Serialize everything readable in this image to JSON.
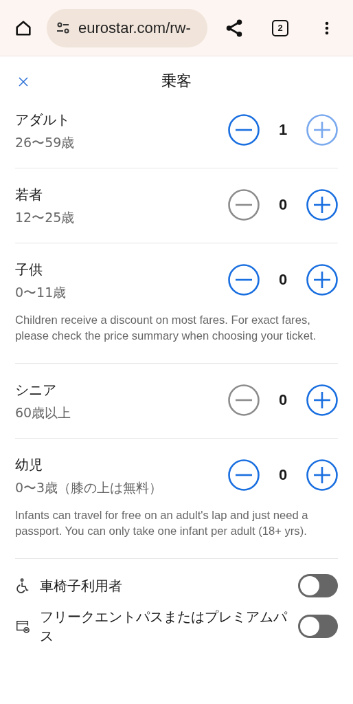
{
  "browser": {
    "url": "eurostar.com/rw-",
    "tab_count": "2"
  },
  "dialog": {
    "title": "乗客"
  },
  "passengers": [
    {
      "name": "アダルト",
      "age": "26〜59歳",
      "count": "1",
      "minus_enabled": true,
      "plus_enabled": false
    },
    {
      "name": "若者",
      "age": "12〜25歳",
      "count": "0",
      "minus_enabled": false,
      "plus_enabled": true
    },
    {
      "name": "子供",
      "age": "0〜11歳",
      "count": "0",
      "minus_enabled": true,
      "plus_enabled": true,
      "note": "Children receive a discount on most fares. For exact fares, please check the price summary when choosing your ticket."
    },
    {
      "name": "シニア",
      "age": "60歳以上",
      "count": "0",
      "minus_enabled": false,
      "plus_enabled": true
    },
    {
      "name": "幼児",
      "age": "0〜3歳（膝の上は無料）",
      "count": "0",
      "minus_enabled": true,
      "plus_enabled": true,
      "note": "Infants can travel for free on an adult's lap and just need a passport. You can only take one infant per adult (18+ yrs)."
    }
  ],
  "options": [
    {
      "kind": "wheelchair",
      "label": "車椅子利用者",
      "on": false
    },
    {
      "kind": "pass",
      "label": "フリークエントパスまたはプレミアムパス",
      "on": false
    }
  ]
}
